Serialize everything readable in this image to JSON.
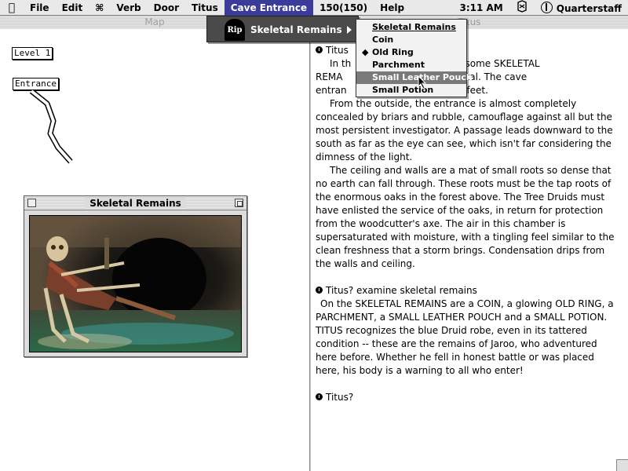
{
  "menubar": {
    "items": [
      "File",
      "Edit",
      "⌘",
      "Verb",
      "Door",
      "Titus",
      "Cave Entrance",
      "150(150)",
      "Help"
    ],
    "active_index": 6,
    "clock": "3:11 AM",
    "weapon": "Quarterstaff"
  },
  "map": {
    "title": "Map",
    "level_label": "Level 1",
    "entrance_label": "Entrance"
  },
  "skeletal_window": {
    "title": "Skeletal Remains"
  },
  "cave_menu": {
    "icon_text": "Rip",
    "item_label": "Skeletal Remains"
  },
  "submenu": {
    "header": "Skeletal Remains",
    "items": [
      {
        "label": "Coin",
        "checked": false,
        "highlighted": false
      },
      {
        "label": "Old Ring",
        "checked": true,
        "highlighted": false
      },
      {
        "label": "Parchment",
        "checked": false,
        "highlighted": false
      },
      {
        "label": "Small Leather Pouch",
        "checked": false,
        "highlighted": true
      },
      {
        "label": "Small Potion",
        "checked": false,
        "highlighted": false
      }
    ]
  },
  "text_window": {
    "title": "Titus",
    "prompt1": "Titus",
    "intro_line1": "In th",
    "intro_rest1": "tus finds some SKELETAL",
    "intro_line2": "REMA",
    "intro_rest2": "a portal.  The cave",
    "intro_line3": "entran",
    "intro_rest3": "of  6 feet.",
    "para_outside": "From the outside, the entrance is almost completely concealed by briars and rubble, camouflage against all but the most persistent investigator.  A passage leads downward to the south as far as the eye can see, which isn't far considering the dimness of the light.",
    "para_ceiling": "The ceiling and walls are a mat of small roots so dense that no earth can fall through.  These roots must be the tap roots of the enormous oaks in the forest above.  The Tree Druids must have enlisted the service of the oaks, in return for protection from the woodcutter's axe.  The air in this chamber is supersaturated with moisture, with a tingling feel similar to the clean freshness that a storm brings.  Condensation drips from the walls and ceiling.",
    "prompt2": "Titus? examine skeletal remains",
    "para_remains": "On the SKELETAL REMAINS are a COIN, a glowing OLD RING, a PARCHMENT, a SMALL LEATHER POUCH and a SMALL POTION.  TITUS recognizes the blue Druid robe, even in its tattered condition -- these are the remains of Jaroo, who adventured here before.  Whether he fell in honest battle or was placed here, his body is a warning to all who enter!",
    "prompt3": "Titus?"
  }
}
